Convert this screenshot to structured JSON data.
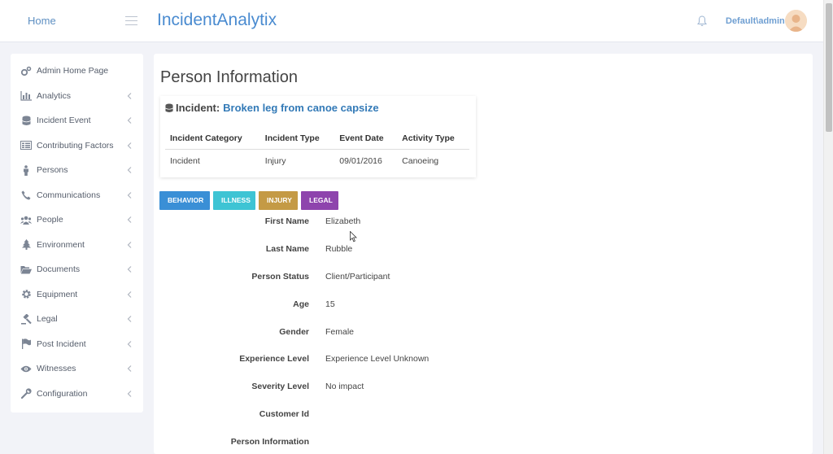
{
  "header": {
    "home_label": "Home",
    "brand": "IncidentAnalytix",
    "user": "Default\\admin"
  },
  "sidebar": {
    "items": [
      {
        "label": "Admin Home Page",
        "icon": "gears-icon",
        "chevron": false
      },
      {
        "label": "Analytics",
        "icon": "bar-chart-icon",
        "chevron": true
      },
      {
        "label": "Incident Event",
        "icon": "database-icon",
        "chevron": true
      },
      {
        "label": "Contributing Factors",
        "icon": "list-card-icon",
        "chevron": true
      },
      {
        "label": "Persons",
        "icon": "person-icon",
        "chevron": true
      },
      {
        "label": "Communications",
        "icon": "phone-icon",
        "chevron": true
      },
      {
        "label": "People",
        "icon": "users-icon",
        "chevron": true
      },
      {
        "label": "Environment",
        "icon": "tree-icon",
        "chevron": true
      },
      {
        "label": "Documents",
        "icon": "folder-open-icon",
        "chevron": true
      },
      {
        "label": "Equipment",
        "icon": "gear-icon",
        "chevron": true
      },
      {
        "label": "Legal",
        "icon": "gavel-icon",
        "chevron": true
      },
      {
        "label": "Post Incident",
        "icon": "flag-icon",
        "chevron": true
      },
      {
        "label": "Witnesses",
        "icon": "eye-icon",
        "chevron": true
      },
      {
        "label": "Configuration",
        "icon": "wrench-icon",
        "chevron": true
      }
    ]
  },
  "main": {
    "page_title": "Person Information",
    "incident": {
      "prefix": "Incident:",
      "name": "Broken leg from canoe capsize",
      "columns": [
        "Incident Category",
        "Incident Type",
        "Event Date",
        "Activity Type"
      ],
      "row": [
        "Incident",
        "Injury",
        "09/01/2016",
        "Canoeing"
      ]
    },
    "tabs": [
      {
        "label": "BEHAVIOR",
        "color": "#3a8fd6"
      },
      {
        "label": "ILLNESS",
        "color": "#3ec4d4"
      },
      {
        "label": "INJURY",
        "color": "#c49a45"
      },
      {
        "label": "LEGAL",
        "color": "#8e44ad"
      }
    ],
    "fields": [
      {
        "label": "First Name",
        "value": "Elizabeth"
      },
      {
        "label": "Last Name",
        "value": "Rubble"
      },
      {
        "label": "Person Status",
        "value": "Client/Participant"
      },
      {
        "label": "Age",
        "value": "15"
      },
      {
        "label": "Gender",
        "value": "Female"
      },
      {
        "label": "Experience Level",
        "value": "Experience Level Unknown"
      },
      {
        "label": "Severity Level",
        "value": "No impact"
      },
      {
        "label": "Customer Id",
        "value": ""
      },
      {
        "label": "Person Information",
        "value": ""
      }
    ]
  },
  "colors": {
    "accent": "#4a8bd0",
    "link": "#337ab7",
    "background": "#f2f3f8"
  }
}
